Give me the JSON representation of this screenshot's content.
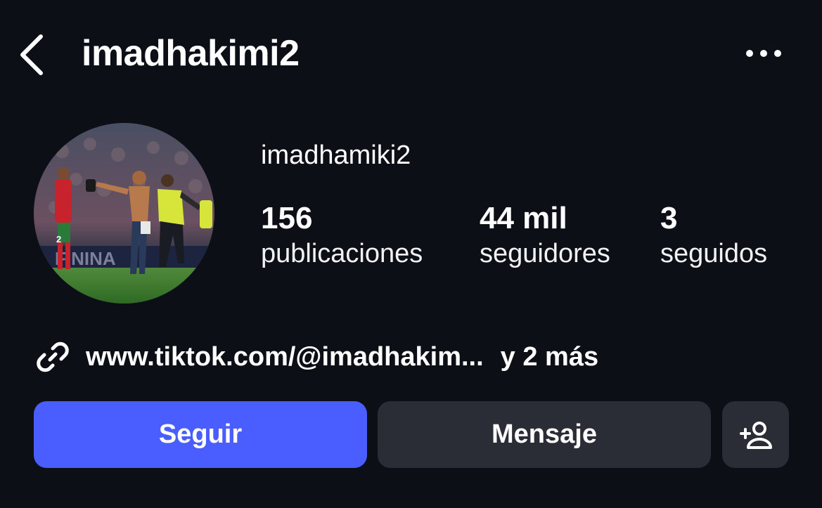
{
  "header": {
    "username": "imadhakimi2",
    "back_icon": "chevron-left-icon",
    "more_icon": "more-horizontal-icon"
  },
  "profile": {
    "display_name": "imadhamiki2",
    "avatar_alt": "profile photo",
    "stats": [
      {
        "value": "156",
        "label": "publicaciones"
      },
      {
        "value": "44 mil",
        "label": "seguidores"
      },
      {
        "value": "3",
        "label": "seguidos"
      }
    ],
    "link": {
      "icon": "link-icon",
      "text": "www.tiktok.com/@imadhakim...",
      "more": "y 2 más"
    }
  },
  "actions": {
    "follow_label": "Seguir",
    "message_label": "Mensaje",
    "suggest_icon": "add-person-icon"
  },
  "colors": {
    "background": "#0c0f16",
    "follow_button": "#4a5dff",
    "secondary_button": "#2a2d35",
    "text": "#ffffff"
  }
}
